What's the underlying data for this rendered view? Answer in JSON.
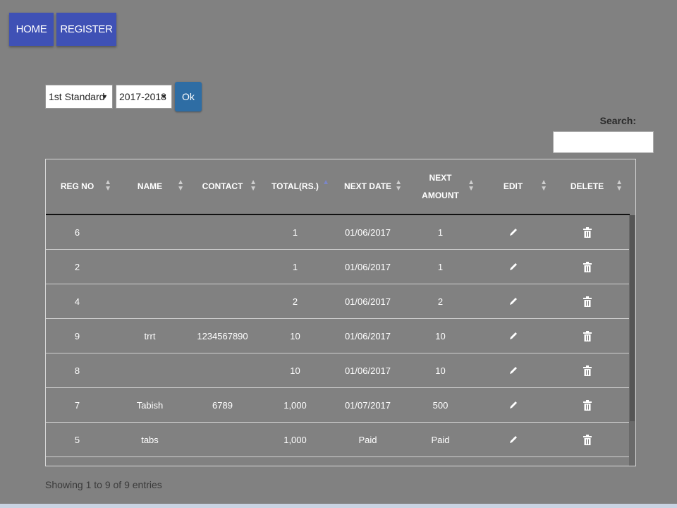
{
  "nav": {
    "home_label": "HOME",
    "register_label": "REGISTER"
  },
  "filters": {
    "standard": "1st Standard",
    "year": "2017-2018",
    "ok_label": "Ok"
  },
  "search": {
    "label": "Search:",
    "value": ""
  },
  "table": {
    "columns": [
      "REG NO",
      "NAME",
      "CONTACT",
      "TOTAL(RS.)",
      "NEXT DATE",
      "NEXT AMOUNT",
      "EDIT",
      "DELETE"
    ],
    "rows": [
      {
        "reg_no": "6",
        "name": "",
        "contact": "",
        "total": "1",
        "next_date": "01/06/2017",
        "next_amount": "1"
      },
      {
        "reg_no": "2",
        "name": "",
        "contact": "",
        "total": "1",
        "next_date": "01/06/2017",
        "next_amount": "1"
      },
      {
        "reg_no": "4",
        "name": "",
        "contact": "",
        "total": "2",
        "next_date": "01/06/2017",
        "next_amount": "2"
      },
      {
        "reg_no": "9",
        "name": "trrt",
        "contact": "1234567890",
        "total": "10",
        "next_date": "01/06/2017",
        "next_amount": "10"
      },
      {
        "reg_no": "8",
        "name": "",
        "contact": "",
        "total": "10",
        "next_date": "01/06/2017",
        "next_amount": "10"
      },
      {
        "reg_no": "7",
        "name": "Tabish",
        "contact": "6789",
        "total": "1,000",
        "next_date": "01/07/2017",
        "next_amount": "500"
      },
      {
        "reg_no": "5",
        "name": "tabs",
        "contact": "",
        "total": "1,000",
        "next_date": "Paid",
        "next_amount": "Paid"
      }
    ]
  },
  "footer": {
    "info": "Showing 1 to 9 of 9 entries"
  },
  "colors": {
    "background": "#818181",
    "nav_button": "#3f51b5",
    "ok_button": "#2e6da4"
  },
  "icons": {
    "edit": "pencil-icon",
    "delete": "trash-icon",
    "sort": "sort-arrows-icon"
  }
}
